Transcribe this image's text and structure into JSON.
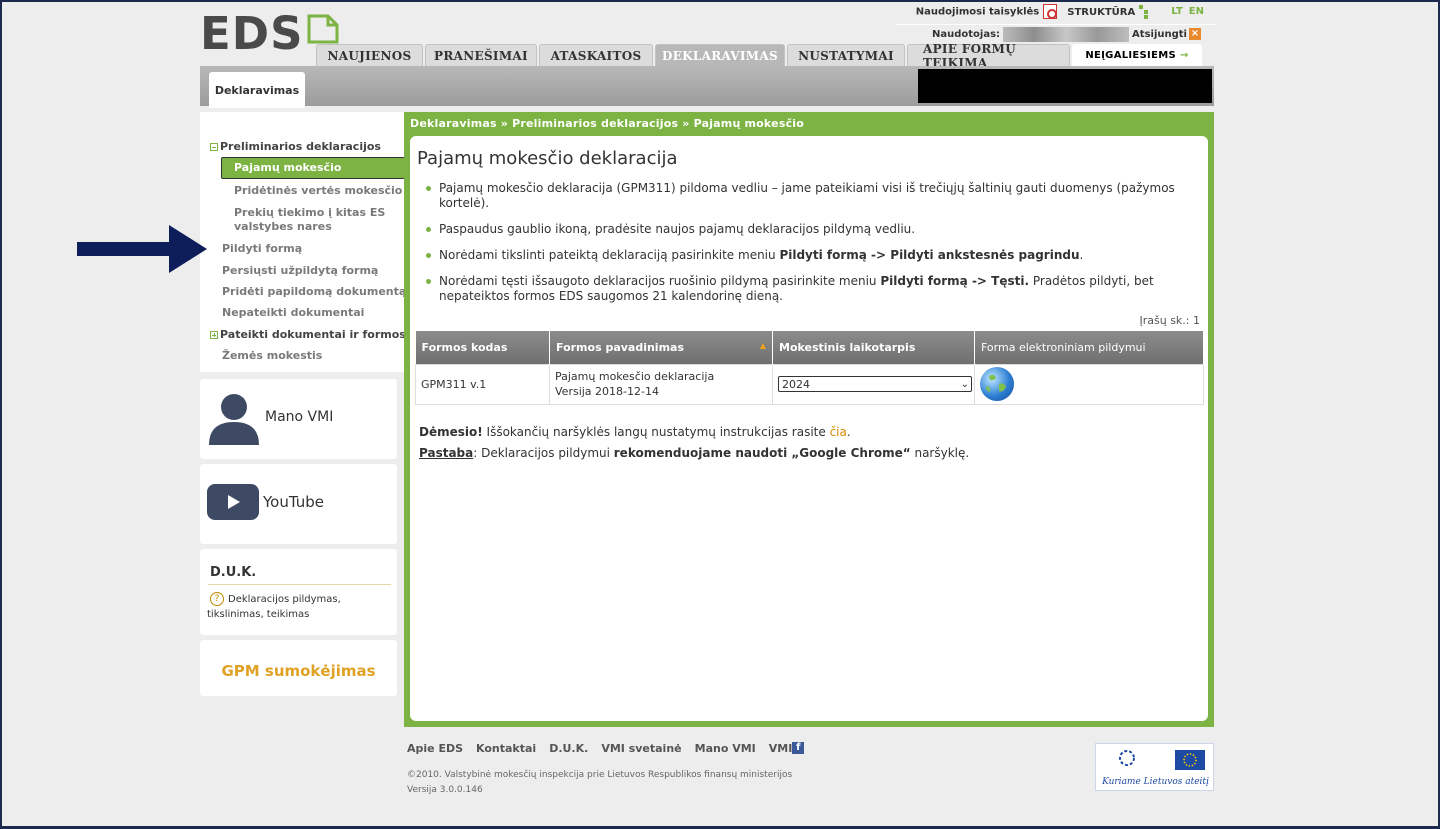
{
  "logo": {
    "text": "EDS"
  },
  "toplinks": {
    "terms": "Naudojimosi taisyklės",
    "structure": "STRUKTŪRA",
    "lang_lt": "LT",
    "lang_en": "EN"
  },
  "user": {
    "label": "Naudotojas:",
    "logout": "Atsijungti"
  },
  "tabs": [
    "NAUJIENOS",
    "PRANEŠIMAI",
    "ATASKAITOS",
    "DEKLARAVIMAS",
    "NUSTATYMAI",
    "APIE FORMŲ TEIKIMĄ"
  ],
  "accessibility": "NEĮGALIESIEMS",
  "subtab": "Deklaravimas",
  "sidebar": {
    "group1": "Preliminarios deklaracijos",
    "item_selected": "Pajamų mokesčio",
    "item2": "Pridėtinės vertės mokesčio",
    "item3a": "Prekių tiekimo į kitas ES",
    "item3b": "valstybes nares",
    "fill_form": "Pildyti formą",
    "send_form": "Persiųsti užpildytą formą",
    "add_doc": "Pridėti papildomą dokumentą",
    "not_submitted": "Nepateikti dokumentai",
    "group2": "Pateikti dokumentai ir formos",
    "land_tax": "Žemės mokestis"
  },
  "cards": {
    "mano_vmi": "Mano VMI",
    "youtube": "YouTube",
    "duk_title": "D.U.K.",
    "duk_text": "Deklaracijos pildymas, tikslinimas, teikimas",
    "gpm": "GPM sumokėjimas"
  },
  "breadcrumb": "Deklaravimas »  Preliminarios deklaracijos  » Pajamų mokesčio",
  "page_title": "Pajamų mokesčio deklaracija",
  "bullets": {
    "b1": "Pajamų mokesčio deklaracija (GPM311) pildoma vedliu – jame pateikiami visi iš trečiųjų šaltinių gauti duomenys (pažymos kortelė).",
    "b2": "Paspaudus gaublio ikoną, pradėsite naujos pajamų deklaracijos pildymą vedliu.",
    "b3_pre": "Norėdami tikslinti pateiktą deklaraciją pasirinkite meniu ",
    "b3_bold": "Pildyti formą -> Pildyti ankstesnės pagrindu",
    "b3_post": ".",
    "b4_pre": "Norėdami tęsti išsaugoto deklaracijos ruošinio pildymą pasirinkite meniu ",
    "b4_bold": "Pildyti formą -> Tęsti.",
    "b4_post": " Pradėtos pildyti, bet nepateiktos formos EDS saugomos 21 kalendorinę dieną."
  },
  "record_count": "Įrašų sk.: 1",
  "table": {
    "headers": [
      "Formos kodas",
      "Formos pavadinimas",
      "Mokestinis laikotarpis",
      "Forma elektroniniam pildymui"
    ],
    "row": {
      "code": "GPM311 v.1",
      "name": "Pajamų mokesčio deklaracija",
      "version": "Versija 2018-12-14",
      "period": "2024"
    }
  },
  "notice": {
    "bold": "Dėmesio!",
    "text": " Iššokančių naršyklės langų nustatymų instrukcijas rasite ",
    "link": "čia",
    "end": "."
  },
  "note": {
    "label": "Pastaba",
    "text": ": Deklaracijos pildymui ",
    "bold": "rekomenduojame naudoti „Google Chrome“",
    "end": " naršyklę."
  },
  "footer": {
    "links": [
      "Apie EDS",
      "Kontaktai",
      "D.U.K.",
      "VMI svetainė",
      "Mano VMI",
      "VMI"
    ],
    "copyright": "©2010. Valstybinė mokesčių inspekcija prie Lietuvos Respublikos finansų ministerijos",
    "version": "Versija 3.0.0.146"
  },
  "eu_badge": "Kuriame Lietuvos ateitį",
  "colors": {
    "accent": "#7cb342",
    "arrow": "#0d1e5a",
    "gpm": "#e0a225"
  }
}
